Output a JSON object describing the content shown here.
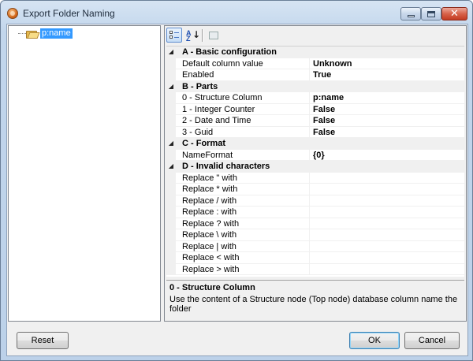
{
  "window": {
    "title": "Export Folder Naming"
  },
  "tree": {
    "items": [
      {
        "label": "p:name",
        "icon": "folder-icon",
        "selected": true
      }
    ]
  },
  "toolbar": {
    "categorized_icon": "categorized-icon",
    "alphabetical_icon": "alphabetical-sort-icon",
    "property_pages_icon": "property-pages-icon"
  },
  "grid": {
    "categories": [
      {
        "label": "A - Basic configuration",
        "props": [
          {
            "name": "Default column value",
            "value": "Unknown"
          },
          {
            "name": "Enabled",
            "value": "True"
          }
        ]
      },
      {
        "label": "B - Parts",
        "props": [
          {
            "name": "0 - Structure Column",
            "value": "p:name"
          },
          {
            "name": "1 - Integer Counter",
            "value": "False"
          },
          {
            "name": "2 - Date and Time",
            "value": "False"
          },
          {
            "name": "3 - Guid",
            "value": "False"
          }
        ]
      },
      {
        "label": "C - Format",
        "props": [
          {
            "name": "NameFormat",
            "value": "{0}"
          }
        ]
      },
      {
        "label": "D - Invalid characters",
        "props": [
          {
            "name": "Replace \" with",
            "value": ""
          },
          {
            "name": "Replace * with",
            "value": ""
          },
          {
            "name": "Replace / with",
            "value": ""
          },
          {
            "name": "Replace : with",
            "value": ""
          },
          {
            "name": "Replace ? with",
            "value": ""
          },
          {
            "name": "Replace \\ with",
            "value": ""
          },
          {
            "name": "Replace | with",
            "value": ""
          },
          {
            "name": "Replace < with",
            "value": ""
          },
          {
            "name": "Replace > with",
            "value": ""
          }
        ]
      }
    ]
  },
  "description": {
    "title": "0 - Structure Column",
    "text": "Use the content of a Structure node (Top node) database column name the folder"
  },
  "buttons": {
    "reset": "Reset",
    "ok": "OK",
    "cancel": "Cancel"
  },
  "colors": {
    "selection": "#3399ff",
    "title_bar": "#c2d6ec",
    "close_button": "#c33b22"
  }
}
